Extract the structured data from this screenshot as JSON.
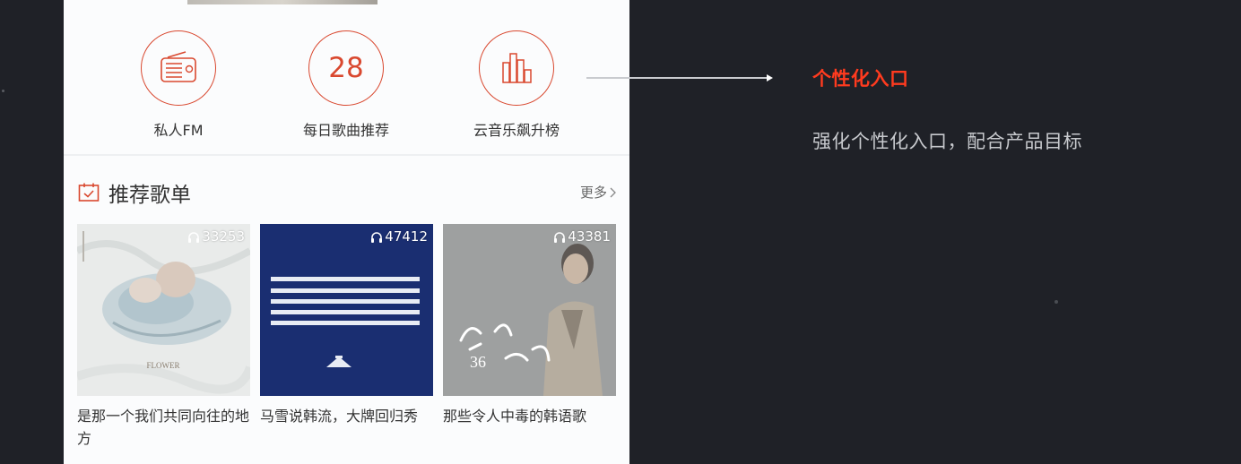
{
  "entries": [
    {
      "label": "私人FM",
      "icon": "radio-icon"
    },
    {
      "label": "每日歌曲推荐",
      "date_number": "28",
      "icon": "calendar-date-icon"
    },
    {
      "label": "云音乐飙升榜",
      "icon": "bar-chart-icon"
    }
  ],
  "section": {
    "title": "推荐歌单",
    "more_label": "更多"
  },
  "playlists": [
    {
      "play_count": "33253",
      "title": "是那一个我们共同向往的地方"
    },
    {
      "play_count": "47412",
      "title": "马雪说韩流，大牌回归秀"
    },
    {
      "play_count": "43381",
      "title": "那些令人中毒的韩语歌"
    }
  ],
  "annotation": {
    "title": "个性化入口",
    "description": "强化个性化入口，配合产品目标"
  },
  "colors": {
    "accent": "#d9482f",
    "annotation_title": "#ff3b1f",
    "background": "#1f2127"
  }
}
